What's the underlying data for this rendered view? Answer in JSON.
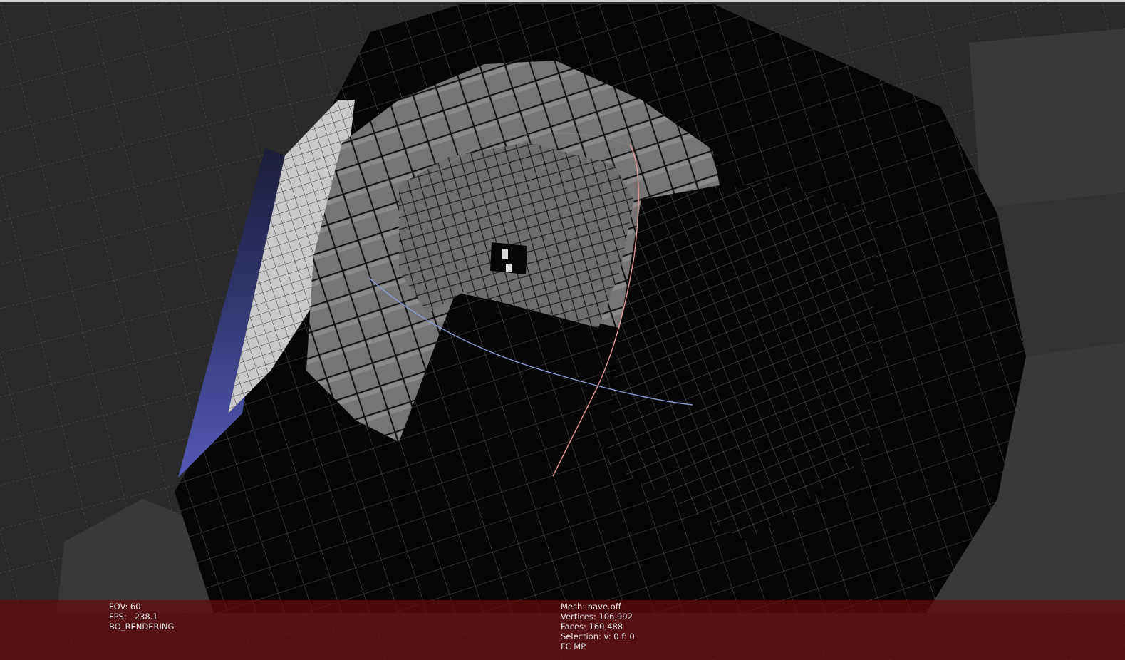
{
  "viewer": {
    "title": "",
    "stats_left": {
      "fov": "FOV: 60",
      "fps": "FPS:   238.1",
      "render_mode": "BO_RENDERING"
    },
    "stats_right": {
      "mesh": "Mesh: nave.off",
      "vertices": "Vertices: 106,992",
      "faces": "Faces: 160,488",
      "selection": "Selection: v: 0 f: 0",
      "flags": "FC MP"
    }
  },
  "colors": {
    "background": "#272727",
    "info_bar": "#680a0a",
    "face_gray": "#6f6f6f",
    "face_light": "#c8c8c8",
    "face_black": "#050505",
    "side_blue": "#4a4fae",
    "arc_blue": "#8c9fd6",
    "arc_red": "#e29a9a"
  }
}
